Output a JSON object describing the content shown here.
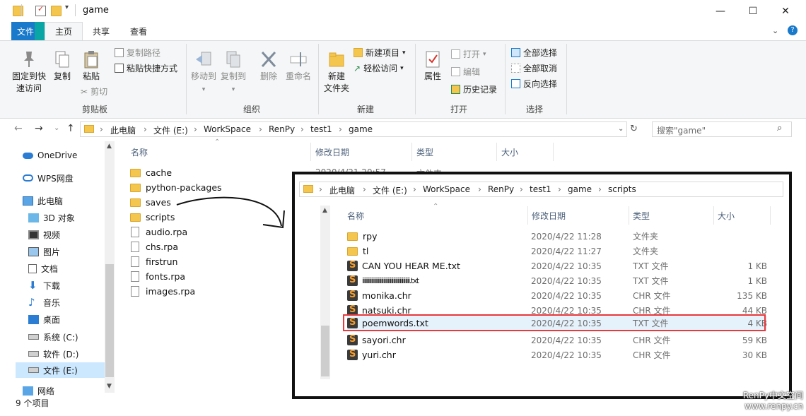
{
  "window": {
    "title": "game",
    "controls": {
      "minimize": "—",
      "maximize": "☐",
      "close": "✕"
    }
  },
  "ribbon": {
    "tabs": [
      "文件",
      "主页",
      "共享",
      "查看"
    ],
    "groups": {
      "clipboard": {
        "label": "剪贴板",
        "pin": "固定到快\n速访问",
        "copy": "复制",
        "paste": "粘贴",
        "copy_path": "复制路径",
        "paste_shortcut": "粘贴快捷方式",
        "cut": "剪切"
      },
      "organize": {
        "label": "组织",
        "move_to": "移动到",
        "copy_to": "复制到",
        "delete": "删除",
        "rename": "重命名"
      },
      "new": {
        "label": "新建",
        "new_folder": "新建\n文件夹",
        "new_item": "新建项目",
        "easy_access": "轻松访问"
      },
      "open": {
        "label": "打开",
        "properties": "属性",
        "open": "打开",
        "edit": "编辑",
        "history": "历史记录"
      },
      "select": {
        "label": "选择",
        "select_all": "全部选择",
        "select_none": "全部取消",
        "invert": "反向选择"
      }
    }
  },
  "address": {
    "crumbs": [
      "此电脑",
      "文件 (E:)",
      "WorkSpace",
      "RenPy",
      "test1",
      "game"
    ],
    "search_placeholder": "搜索\"game\""
  },
  "nav_pane": {
    "items": [
      {
        "label": "OneDrive",
        "icon": "cloud-icon"
      },
      {
        "label": "WPS网盘",
        "icon": "cloud-drive-icon"
      },
      {
        "label": "此电脑",
        "icon": "computer-icon"
      },
      {
        "label": "3D 对象",
        "icon": "cube-icon"
      },
      {
        "label": "视频",
        "icon": "video-icon"
      },
      {
        "label": "图片",
        "icon": "picture-icon"
      },
      {
        "label": "文档",
        "icon": "document-icon"
      },
      {
        "label": "下载",
        "icon": "download-icon"
      },
      {
        "label": "音乐",
        "icon": "music-icon"
      },
      {
        "label": "桌面",
        "icon": "desktop-icon"
      },
      {
        "label": "系统 (C:)",
        "icon": "drive-icon"
      },
      {
        "label": "软件 (D:)",
        "icon": "drive-icon"
      },
      {
        "label": "文件 (E:)",
        "icon": "drive-icon"
      },
      {
        "label": "网络",
        "icon": "network-icon"
      }
    ]
  },
  "file_list": {
    "columns": [
      "名称",
      "修改日期",
      "类型",
      "大小"
    ],
    "visible_date": "2020/4/21 20:57",
    "visible_type": "文件夹",
    "items": [
      {
        "name": "cache",
        "kind": "folder"
      },
      {
        "name": "python-packages",
        "kind": "folder"
      },
      {
        "name": "saves",
        "kind": "folder"
      },
      {
        "name": "scripts",
        "kind": "folder"
      },
      {
        "name": "audio.rpa",
        "kind": "file"
      },
      {
        "name": "chs.rpa",
        "kind": "file"
      },
      {
        "name": "firstrun",
        "kind": "file"
      },
      {
        "name": "fonts.rpa",
        "kind": "file"
      },
      {
        "name": "images.rpa",
        "kind": "file"
      }
    ],
    "status": "9 个项目"
  },
  "overlay": {
    "crumbs": [
      "此电脑",
      "文件 (E:)",
      "WorkSpace",
      "RenPy",
      "test1",
      "game",
      "scripts"
    ],
    "columns": [
      "名称",
      "修改日期",
      "类型",
      "大小"
    ],
    "rows": [
      {
        "name": "rpy",
        "date": "2020/4/22 11:28",
        "type": "文件夹",
        "size": "",
        "kind": "folder"
      },
      {
        "name": "tl",
        "date": "2020/4/22 11:27",
        "type": "文件夹",
        "size": "",
        "kind": "folder"
      },
      {
        "name": "CAN YOU HEAR ME.txt",
        "date": "2020/4/22 10:35",
        "type": "TXT 文件",
        "size": "1 KB",
        "kind": "sublime"
      },
      {
        "name": "iiiiiiiiiiiiiiiiiiiiiiiiiiiiiiiiiiiiiiiiiii.txt",
        "date": "2020/4/22 10:35",
        "type": "TXT 文件",
        "size": "1 KB",
        "kind": "sublime"
      },
      {
        "name": "monika.chr",
        "date": "2020/4/22 10:35",
        "type": "CHR 文件",
        "size": "135 KB",
        "kind": "sublime"
      },
      {
        "name": "natsuki.chr",
        "date": "2020/4/22 10:35",
        "type": "CHR 文件",
        "size": "44 KB",
        "kind": "sublime"
      },
      {
        "name": "poemwords.txt",
        "date": "2020/4/22 10:35",
        "type": "TXT 文件",
        "size": "4 KB",
        "kind": "sublime"
      },
      {
        "name": "sayori.chr",
        "date": "2020/4/22 10:35",
        "type": "CHR 文件",
        "size": "59 KB",
        "kind": "sublime"
      },
      {
        "name": "yuri.chr",
        "date": "2020/4/22 10:35",
        "type": "CHR 文件",
        "size": "30 KB",
        "kind": "sublime"
      }
    ],
    "highlight_color": "#e8393c"
  },
  "watermark": {
    "line1": "RenPy中文空间",
    "line2": "www.renpy.cn"
  }
}
